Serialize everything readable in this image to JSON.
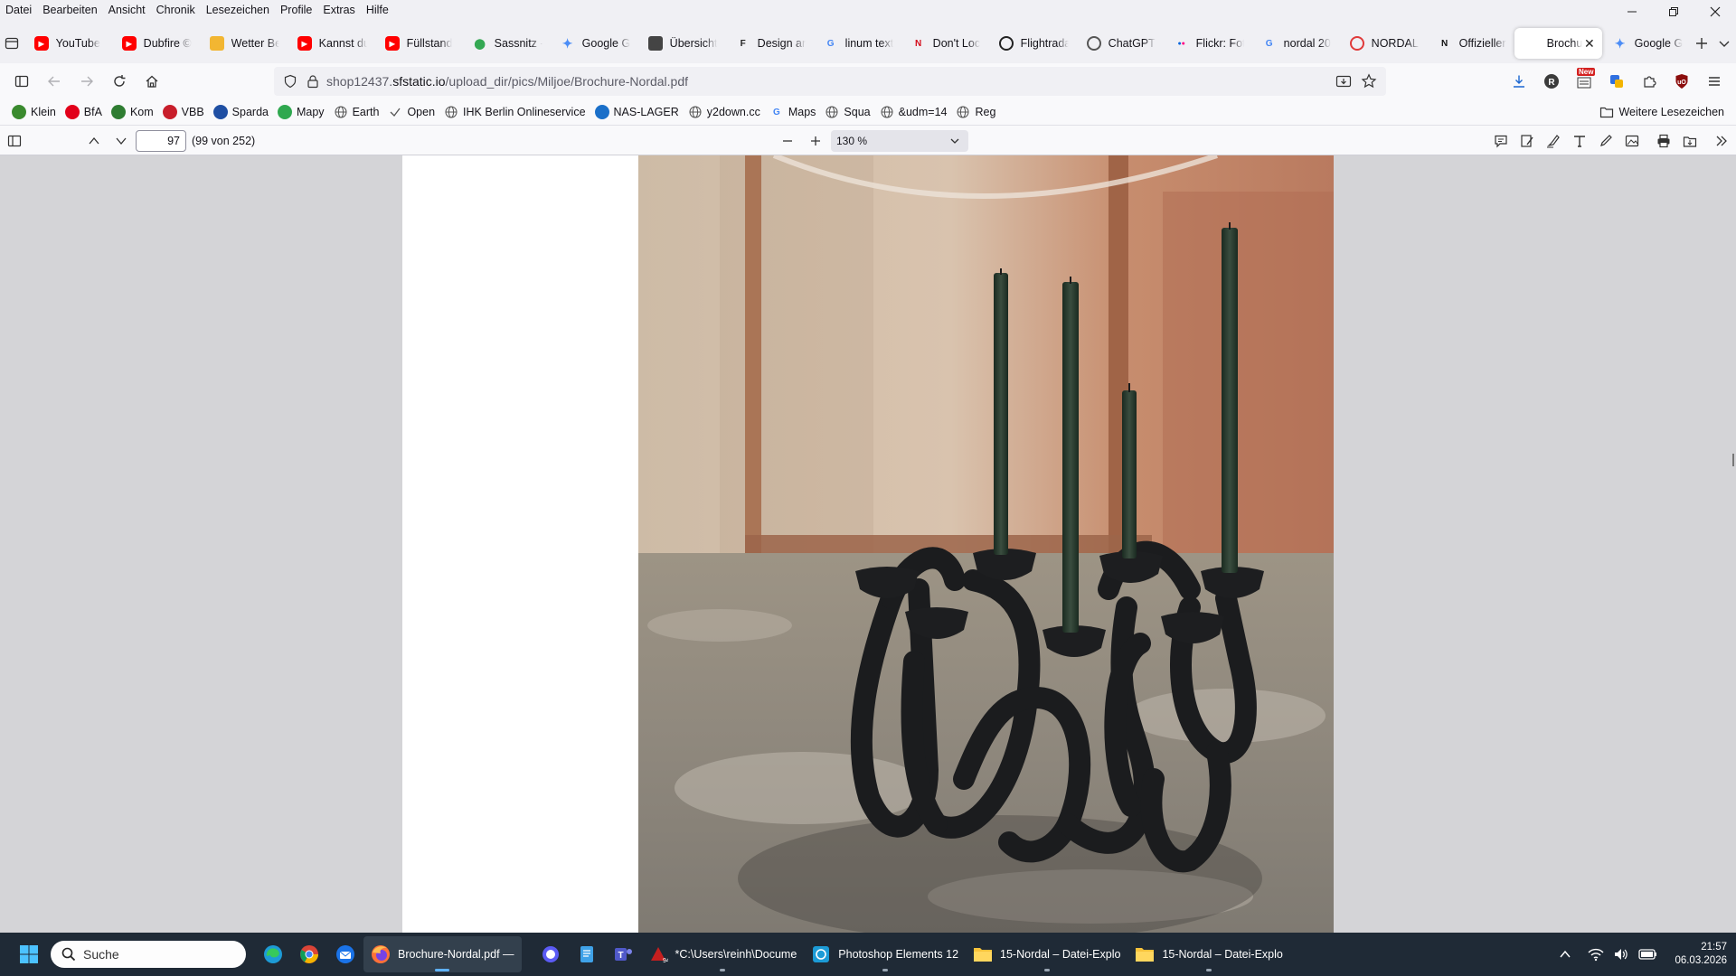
{
  "menu": [
    "Datei",
    "Bearbeiten",
    "Ansicht",
    "Chronik",
    "Lesezeichen",
    "Profile",
    "Extras",
    "Hilfe"
  ],
  "tabs": [
    {
      "label": "YouTube",
      "icon": "youtube-icon",
      "color": "#ff0000"
    },
    {
      "label": "Dubfire ©",
      "icon": "youtube-icon",
      "color": "#ff0000"
    },
    {
      "label": "Wetter Be",
      "icon": "weather-icon",
      "color": "#f2b632"
    },
    {
      "label": "Kannst du",
      "icon": "youtube-icon",
      "color": "#ff0000"
    },
    {
      "label": "Füllstand",
      "icon": "youtube-icon",
      "color": "#ff0000"
    },
    {
      "label": "Sassnitz -",
      "icon": "maps-pin-icon",
      "color": "#34a853"
    },
    {
      "label": "Google G",
      "icon": "gemini-icon",
      "color": "#4c8df6"
    },
    {
      "label": "Übersicht",
      "icon": "cube-icon",
      "color": "#444444"
    },
    {
      "label": "Design ar",
      "icon": "f-logo-icon",
      "color": "#222222"
    },
    {
      "label": "linum text",
      "icon": "google-icon",
      "color": "#4285f4"
    },
    {
      "label": "Don't Loc",
      "icon": "n-logo-icon",
      "color": "#d40b1b"
    },
    {
      "label": "Flightrada",
      "icon": "radar-icon",
      "color": "#222222"
    },
    {
      "label": "ChatGPT",
      "icon": "chatgpt-icon",
      "color": "#555555"
    },
    {
      "label": "Flickr: Fot",
      "icon": "flickr-icon",
      "color": "#ff0084"
    },
    {
      "label": "nordal 20",
      "icon": "google-icon",
      "color": "#4285f4"
    },
    {
      "label": "NORDAL -",
      "icon": "target-icon",
      "color": "#e03a3a"
    },
    {
      "label": "Offizieller",
      "icon": "n-logo-icon",
      "color": "#111111"
    },
    {
      "label": "Brochu",
      "icon": "pdf-icon",
      "color": "#ffffff",
      "active": true
    },
    {
      "label": "Google G",
      "icon": "gemini-icon",
      "color": "#4c8df6"
    }
  ],
  "url": {
    "prefix": "shop12437.",
    "domain": "sfstatic.io",
    "path": "/upload_dir/pics/Miljoe/Brochure-Nordal.pdf"
  },
  "bookmarks": [
    {
      "label": "Klein",
      "icon": "leaf-icon",
      "color": "#3a8a2e"
    },
    {
      "label": "BfA",
      "icon": "bfa-icon",
      "color": "#e2001a"
    },
    {
      "label": "Kom",
      "icon": "kom-icon",
      "color": "#2f7d32"
    },
    {
      "label": "VBB",
      "icon": "vbb-icon",
      "color": "#c81e2b"
    },
    {
      "label": "Sparda",
      "icon": "sparda-icon",
      "color": "#1f4fa3"
    },
    {
      "label": "Mapy",
      "icon": "mapy-icon",
      "color": "#2fa84f"
    },
    {
      "label": "Earth",
      "icon": "globe-icon",
      "color": "#666666"
    },
    {
      "label": "Open",
      "icon": "check-icon",
      "color": "#666666"
    },
    {
      "label": "IHK Berlin Onlineservice",
      "icon": "globe-icon",
      "color": "#666666"
    },
    {
      "label": "NAS-LAGER",
      "icon": "nas-icon",
      "color": "#1a6fc9"
    },
    {
      "label": "y2down.cc",
      "icon": "globe-icon",
      "color": "#666666"
    },
    {
      "label": "Maps",
      "icon": "google-icon",
      "color": "#4285f4"
    },
    {
      "label": "Squa",
      "icon": "globe-icon",
      "color": "#666666"
    },
    {
      "label": "&udm=14",
      "icon": "globe-icon",
      "color": "#666666"
    },
    {
      "label": "Reg",
      "icon": "globe-icon",
      "color": "#666666"
    }
  ],
  "other_bookmarks": "Weitere Lesezeichen",
  "pdf": {
    "page": "97",
    "page_info": "(99 von 252)",
    "zoom": "130 %"
  },
  "taskbar": {
    "search_placeholder": "Suche",
    "apps": [
      {
        "label": "Brochure-Nordal.pdf —",
        "icon": "firefox-icon",
        "active": true
      },
      {
        "label": "*C:\\Users\\reinh\\Docume",
        "icon": "pdf-editor-icon"
      },
      {
        "label": "Photoshop Elements 12",
        "icon": "photoshop-elements-icon"
      },
      {
        "label": "15-Nordal – Datei-Explo",
        "icon": "folder-icon"
      },
      {
        "label": "15-Nordal – Datei-Explo",
        "icon": "folder-icon"
      }
    ],
    "time": "21:57",
    "date": "06.03.2026"
  },
  "new_badge": "New"
}
